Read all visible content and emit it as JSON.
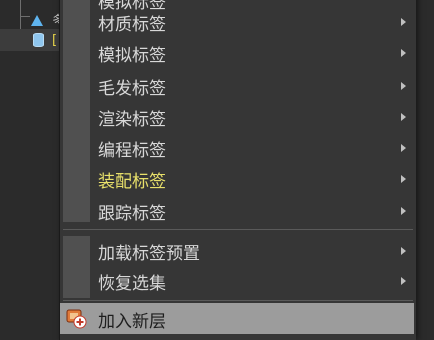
{
  "tree": {
    "row1_text": "多",
    "row2_text": "[",
    "row2_selected": true
  },
  "menu": {
    "partial_top_label": "模拟标签",
    "items": [
      {
        "label": "材质标签",
        "submenu": true
      },
      {
        "label": "模拟标签",
        "submenu": true
      },
      {
        "label": "毛发标签",
        "submenu": true
      },
      {
        "label": "渲染标签",
        "submenu": true
      },
      {
        "label": "编程标签",
        "submenu": true
      },
      {
        "label": "装配标签",
        "submenu": true,
        "accent": true
      },
      {
        "label": "跟踪标签",
        "submenu": true
      }
    ],
    "group2": [
      {
        "label": "加载标签预置",
        "submenu": true
      },
      {
        "label": "恢复选集",
        "submenu": true
      }
    ],
    "highlighted": {
      "label": "加入新层",
      "icon": "add-layer-icon"
    }
  },
  "colors": {
    "accent_text": "#e8e06a",
    "highlight_bg": "#9c9c9c",
    "menu_bg": "#363636"
  }
}
